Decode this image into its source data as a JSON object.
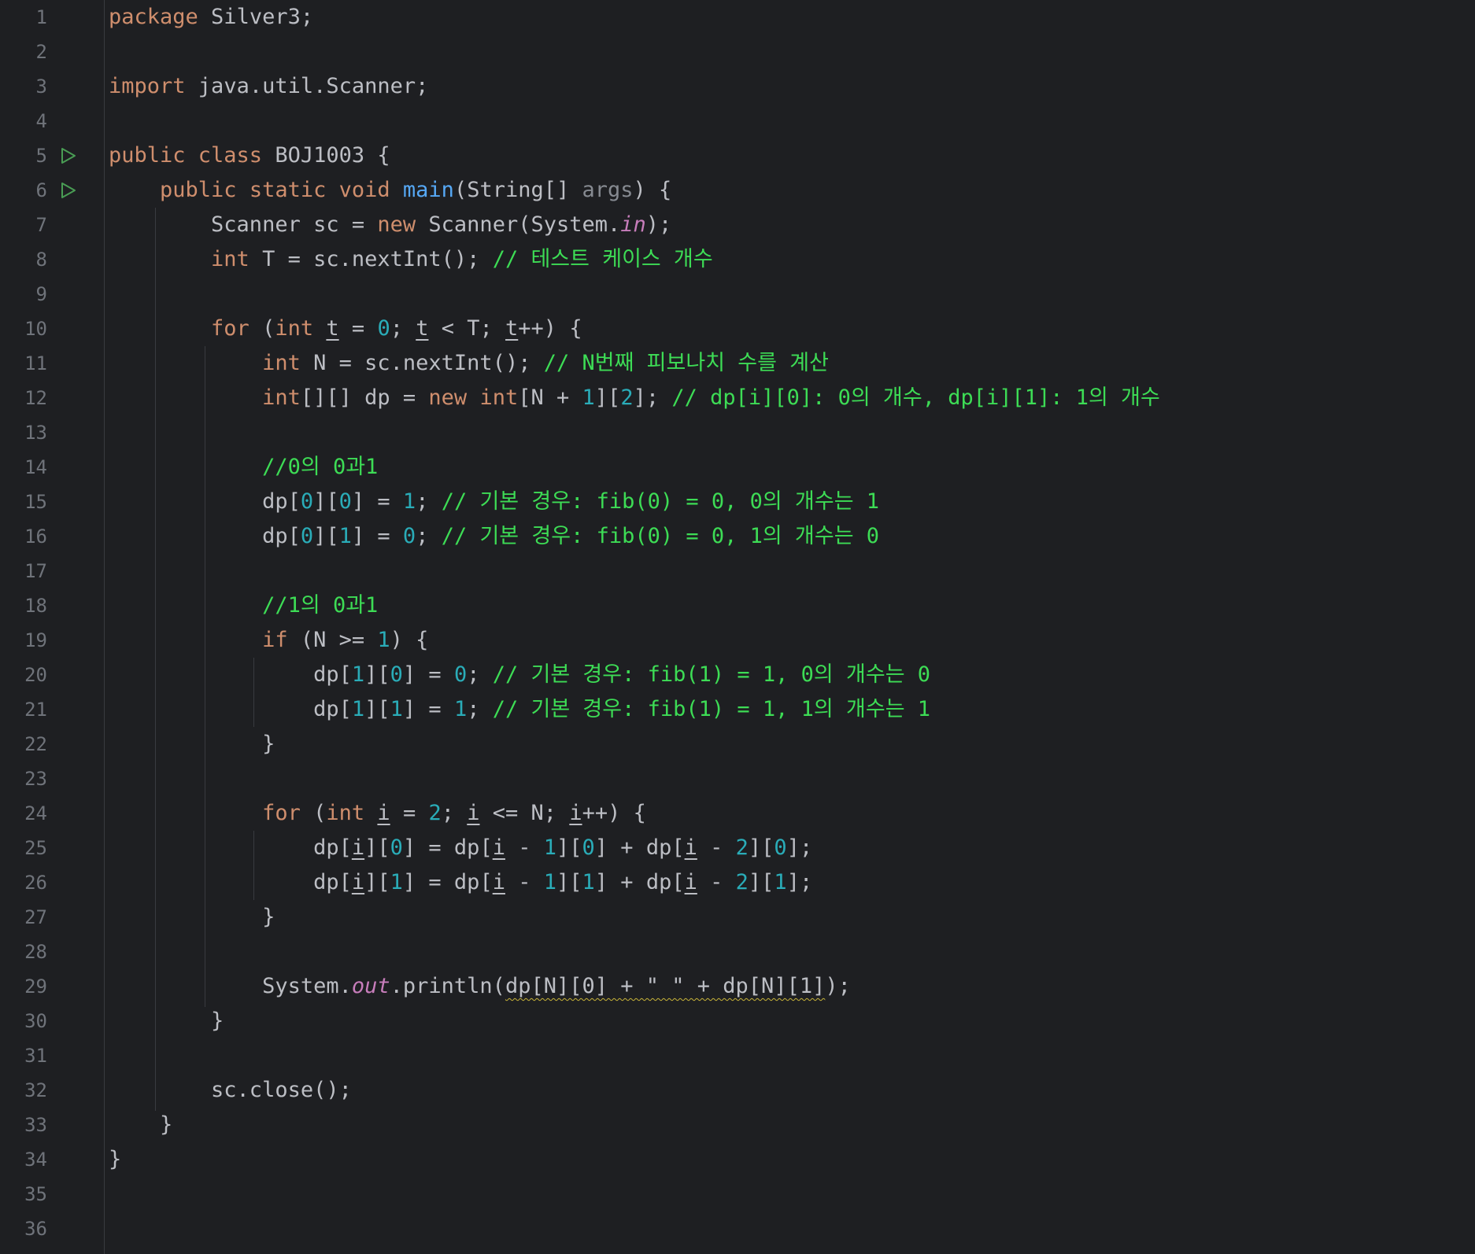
{
  "editor": {
    "language": "java",
    "theme_colors": {
      "background": "#1e1f22",
      "gutter_text": "#6f737a",
      "keyword": "#cf8e6d",
      "plain": "#bcbec4",
      "number": "#2aacb8",
      "comment": "#3ddc55",
      "function": "#56a8f5",
      "static_field": "#c77dbb",
      "unused_param": "#868a91",
      "run_icon": "#499c54"
    },
    "run_gutter_icons": [
      {
        "line": 5,
        "icon": "run-icon"
      },
      {
        "line": 6,
        "icon": "run-icon"
      }
    ],
    "lines": [
      {
        "num": "1",
        "tokens": [
          {
            "t": "package",
            "c": "kw"
          },
          {
            "t": " Silver3;",
            "c": "plain"
          }
        ]
      },
      {
        "num": "2",
        "tokens": []
      },
      {
        "num": "3",
        "tokens": [
          {
            "t": "import",
            "c": "kw"
          },
          {
            "t": " java.util.Scanner;",
            "c": "plain"
          }
        ]
      },
      {
        "num": "4",
        "tokens": []
      },
      {
        "num": "5",
        "tokens": [
          {
            "t": "public class",
            "c": "kw"
          },
          {
            "t": " BOJ1003 {",
            "c": "plain"
          }
        ]
      },
      {
        "num": "6",
        "tokens": [
          {
            "t": "    ",
            "c": "plain"
          },
          {
            "t": "public static void",
            "c": "kw"
          },
          {
            "t": " ",
            "c": "plain"
          },
          {
            "t": "main",
            "c": "fn"
          },
          {
            "t": "(String[] ",
            "c": "plain"
          },
          {
            "t": "args",
            "c": "unused"
          },
          {
            "t": ") {",
            "c": "plain"
          }
        ]
      },
      {
        "num": "7",
        "tokens": [
          {
            "t": "        Scanner sc = ",
            "c": "plain"
          },
          {
            "t": "new",
            "c": "kw"
          },
          {
            "t": " Scanner(System.",
            "c": "plain"
          },
          {
            "t": "in",
            "c": "static"
          },
          {
            "t": ");",
            "c": "plain"
          }
        ]
      },
      {
        "num": "8",
        "tokens": [
          {
            "t": "        ",
            "c": "plain"
          },
          {
            "t": "int",
            "c": "kw"
          },
          {
            "t": " T = sc.nextInt(); ",
            "c": "plain"
          },
          {
            "t": "// 테스트 케이스 개수",
            "c": "comment"
          }
        ]
      },
      {
        "num": "9",
        "tokens": []
      },
      {
        "num": "10",
        "tokens": [
          {
            "t": "        ",
            "c": "plain"
          },
          {
            "t": "for",
            "c": "kw"
          },
          {
            "t": " (",
            "c": "plain"
          },
          {
            "t": "int",
            "c": "kw"
          },
          {
            "t": " ",
            "c": "plain"
          },
          {
            "t": "t",
            "c": "var"
          },
          {
            "t": " = ",
            "c": "plain"
          },
          {
            "t": "0",
            "c": "num"
          },
          {
            "t": "; ",
            "c": "plain"
          },
          {
            "t": "t",
            "c": "var"
          },
          {
            "t": " < T; ",
            "c": "plain"
          },
          {
            "t": "t",
            "c": "var"
          },
          {
            "t": "++) {",
            "c": "plain"
          }
        ]
      },
      {
        "num": "11",
        "tokens": [
          {
            "t": "            ",
            "c": "plain"
          },
          {
            "t": "int",
            "c": "kw"
          },
          {
            "t": " N = sc.nextInt(); ",
            "c": "plain"
          },
          {
            "t": "// N번째 피보나치 수를 계산",
            "c": "comment"
          }
        ]
      },
      {
        "num": "12",
        "tokens": [
          {
            "t": "            ",
            "c": "plain"
          },
          {
            "t": "int",
            "c": "kw"
          },
          {
            "t": "[][] dp = ",
            "c": "plain"
          },
          {
            "t": "new",
            "c": "kw"
          },
          {
            "t": " ",
            "c": "plain"
          },
          {
            "t": "int",
            "c": "kw"
          },
          {
            "t": "[N + ",
            "c": "plain"
          },
          {
            "t": "1",
            "c": "num"
          },
          {
            "t": "][",
            "c": "plain"
          },
          {
            "t": "2",
            "c": "num"
          },
          {
            "t": "]; ",
            "c": "plain"
          },
          {
            "t": "// dp[i][0]: 0의 개수, dp[i][1]: 1의 개수",
            "c": "comment"
          }
        ]
      },
      {
        "num": "13",
        "tokens": []
      },
      {
        "num": "14",
        "tokens": [
          {
            "t": "            ",
            "c": "plain"
          },
          {
            "t": "//0의 0과1",
            "c": "comment"
          }
        ]
      },
      {
        "num": "15",
        "tokens": [
          {
            "t": "            dp[",
            "c": "plain"
          },
          {
            "t": "0",
            "c": "num"
          },
          {
            "t": "][",
            "c": "plain"
          },
          {
            "t": "0",
            "c": "num"
          },
          {
            "t": "] = ",
            "c": "plain"
          },
          {
            "t": "1",
            "c": "num"
          },
          {
            "t": "; ",
            "c": "plain"
          },
          {
            "t": "// 기본 경우: fib(0) = 0, 0의 개수는 1",
            "c": "comment"
          }
        ]
      },
      {
        "num": "16",
        "tokens": [
          {
            "t": "            dp[",
            "c": "plain"
          },
          {
            "t": "0",
            "c": "num"
          },
          {
            "t": "][",
            "c": "plain"
          },
          {
            "t": "1",
            "c": "num"
          },
          {
            "t": "] = ",
            "c": "plain"
          },
          {
            "t": "0",
            "c": "num"
          },
          {
            "t": "; ",
            "c": "plain"
          },
          {
            "t": "// 기본 경우: fib(0) = 0, 1의 개수는 0",
            "c": "comment"
          }
        ]
      },
      {
        "num": "17",
        "tokens": []
      },
      {
        "num": "18",
        "tokens": [
          {
            "t": "            ",
            "c": "plain"
          },
          {
            "t": "//1의 0과1",
            "c": "comment"
          }
        ]
      },
      {
        "num": "19",
        "tokens": [
          {
            "t": "            ",
            "c": "plain"
          },
          {
            "t": "if",
            "c": "kw"
          },
          {
            "t": " (N >= ",
            "c": "plain"
          },
          {
            "t": "1",
            "c": "num"
          },
          {
            "t": ") {",
            "c": "plain"
          }
        ]
      },
      {
        "num": "20",
        "tokens": [
          {
            "t": "                dp[",
            "c": "plain"
          },
          {
            "t": "1",
            "c": "num"
          },
          {
            "t": "][",
            "c": "plain"
          },
          {
            "t": "0",
            "c": "num"
          },
          {
            "t": "] = ",
            "c": "plain"
          },
          {
            "t": "0",
            "c": "num"
          },
          {
            "t": "; ",
            "c": "plain"
          },
          {
            "t": "// 기본 경우: fib(1) = 1, 0의 개수는 0",
            "c": "comment"
          }
        ]
      },
      {
        "num": "21",
        "tokens": [
          {
            "t": "                dp[",
            "c": "plain"
          },
          {
            "t": "1",
            "c": "num"
          },
          {
            "t": "][",
            "c": "plain"
          },
          {
            "t": "1",
            "c": "num"
          },
          {
            "t": "] = ",
            "c": "plain"
          },
          {
            "t": "1",
            "c": "num"
          },
          {
            "t": "; ",
            "c": "plain"
          },
          {
            "t": "// 기본 경우: fib(1) = 1, 1의 개수는 1",
            "c": "comment"
          }
        ]
      },
      {
        "num": "22",
        "tokens": [
          {
            "t": "            }",
            "c": "plain"
          }
        ]
      },
      {
        "num": "23",
        "tokens": []
      },
      {
        "num": "24",
        "tokens": [
          {
            "t": "            ",
            "c": "plain"
          },
          {
            "t": "for",
            "c": "kw"
          },
          {
            "t": " (",
            "c": "plain"
          },
          {
            "t": "int",
            "c": "kw"
          },
          {
            "t": " ",
            "c": "plain"
          },
          {
            "t": "i",
            "c": "var"
          },
          {
            "t": " = ",
            "c": "plain"
          },
          {
            "t": "2",
            "c": "num"
          },
          {
            "t": "; ",
            "c": "plain"
          },
          {
            "t": "i",
            "c": "var"
          },
          {
            "t": " <= N; ",
            "c": "plain"
          },
          {
            "t": "i",
            "c": "var"
          },
          {
            "t": "++) {",
            "c": "plain"
          }
        ]
      },
      {
        "num": "25",
        "tokens": [
          {
            "t": "                dp[",
            "c": "plain"
          },
          {
            "t": "i",
            "c": "var"
          },
          {
            "t": "][",
            "c": "plain"
          },
          {
            "t": "0",
            "c": "num"
          },
          {
            "t": "] = dp[",
            "c": "plain"
          },
          {
            "t": "i",
            "c": "var"
          },
          {
            "t": " - ",
            "c": "plain"
          },
          {
            "t": "1",
            "c": "num"
          },
          {
            "t": "][",
            "c": "plain"
          },
          {
            "t": "0",
            "c": "num"
          },
          {
            "t": "] + dp[",
            "c": "plain"
          },
          {
            "t": "i",
            "c": "var"
          },
          {
            "t": " - ",
            "c": "plain"
          },
          {
            "t": "2",
            "c": "num"
          },
          {
            "t": "][",
            "c": "plain"
          },
          {
            "t": "0",
            "c": "num"
          },
          {
            "t": "];",
            "c": "plain"
          }
        ]
      },
      {
        "num": "26",
        "tokens": [
          {
            "t": "                dp[",
            "c": "plain"
          },
          {
            "t": "i",
            "c": "var"
          },
          {
            "t": "][",
            "c": "plain"
          },
          {
            "t": "1",
            "c": "num"
          },
          {
            "t": "] = dp[",
            "c": "plain"
          },
          {
            "t": "i",
            "c": "var"
          },
          {
            "t": " - ",
            "c": "plain"
          },
          {
            "t": "1",
            "c": "num"
          },
          {
            "t": "][",
            "c": "plain"
          },
          {
            "t": "1",
            "c": "num"
          },
          {
            "t": "] + dp[",
            "c": "plain"
          },
          {
            "t": "i",
            "c": "var"
          },
          {
            "t": " - ",
            "c": "plain"
          },
          {
            "t": "2",
            "c": "num"
          },
          {
            "t": "][",
            "c": "plain"
          },
          {
            "t": "1",
            "c": "num"
          },
          {
            "t": "];",
            "c": "plain"
          }
        ]
      },
      {
        "num": "27",
        "tokens": [
          {
            "t": "            }",
            "c": "plain"
          }
        ]
      },
      {
        "num": "28",
        "tokens": []
      },
      {
        "num": "29",
        "tokens": [
          {
            "t": "            System.",
            "c": "plain"
          },
          {
            "t": "out",
            "c": "static"
          },
          {
            "t": ".println(",
            "c": "plain"
          },
          {
            "t": "dp[N][0] + \" \" + dp[N][1]",
            "c": "squiggle"
          },
          {
            "t": ");",
            "c": "plain"
          }
        ]
      },
      {
        "num": "30",
        "tokens": [
          {
            "t": "        }",
            "c": "plain"
          }
        ]
      },
      {
        "num": "31",
        "tokens": []
      },
      {
        "num": "32",
        "tokens": [
          {
            "t": "        sc.close();",
            "c": "plain"
          }
        ]
      },
      {
        "num": "33",
        "tokens": [
          {
            "t": "    }",
            "c": "plain"
          }
        ]
      },
      {
        "num": "34",
        "tokens": [
          {
            "t": "}",
            "c": "plain"
          }
        ]
      },
      {
        "num": "35",
        "tokens": []
      },
      {
        "num": "36",
        "tokens": []
      }
    ]
  }
}
